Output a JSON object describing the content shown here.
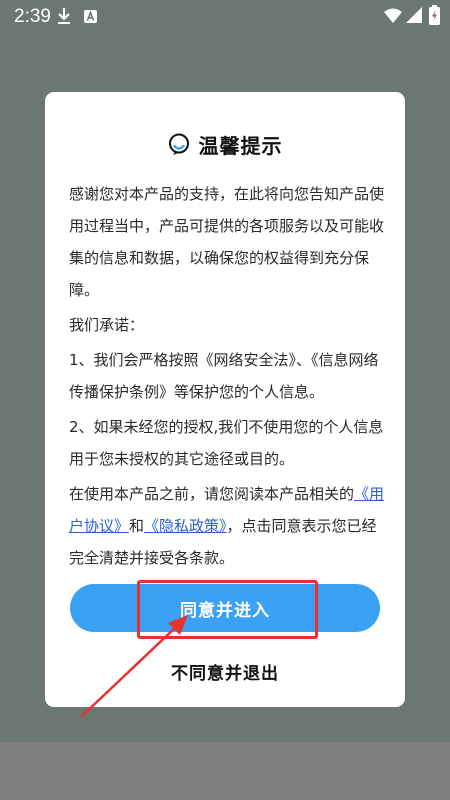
{
  "status_bar": {
    "time": "2:39",
    "icons": [
      "download-icon",
      "a-icon",
      "wifi-icon",
      "signal-icon",
      "battery-icon"
    ]
  },
  "dialog": {
    "title": "温馨提示",
    "icon": "smile-icon",
    "paragraphs": {
      "intro": "感谢您对本产品的支持，在此将向您告知产品使用过程当中，产品可提供的各项服务以及可能收集的信息和数据，以确保您的权益得到充分保障。",
      "promise": "我们承诺：",
      "item1": "1、我们会严格按照《网络安全法》、《信息网络传播保护条例》等保护您的个人信息。",
      "item2": "2、如果未经您的授权,我们不使用您的个人信息用于您未授权的其它途径或目的。",
      "notice_before": "在使用本产品之前，请您阅读本产品相关的",
      "user_agreement": "《用户协议》",
      "and": "和",
      "privacy_policy": "《隐私政策》",
      "notice_after": "，点击同意表示您已经完全清楚并接受各条款。"
    },
    "agree_label": "同意并进入",
    "disagree_label": "不同意并退出"
  },
  "colors": {
    "overlay": "#6b7771",
    "dialog": "#ffffff",
    "primary_button": "#3ba1f4",
    "link": "#2a63c9",
    "annotation": "#e8322e"
  }
}
